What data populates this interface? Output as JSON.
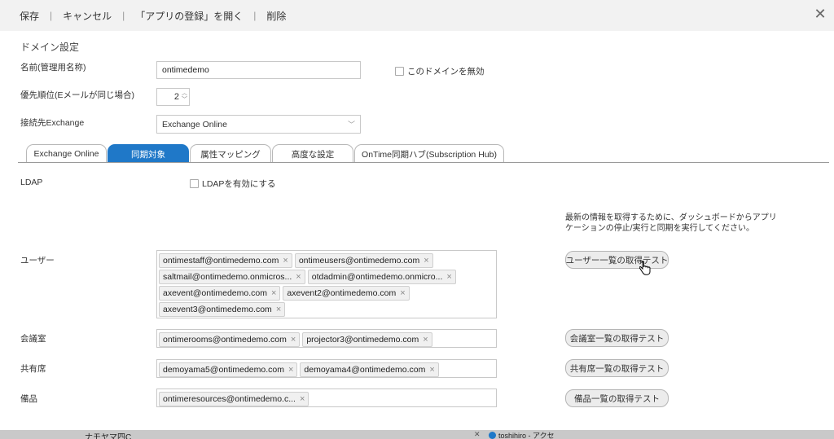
{
  "toolbar": {
    "save": "保存",
    "cancel": "キャンセル",
    "open_app_registration": "「アプリの登録」を開く",
    "delete": "削除",
    "separator": "|",
    "close": "✕"
  },
  "domain_settings": {
    "section_title": "ドメイン設定",
    "name_label": "名前(管理用名称)",
    "name_value": "ontimedemo",
    "disable_label": "このドメインを無効",
    "priority_label": "優先順位(Eメールが同じ場合)",
    "priority_value": "2",
    "exchange_label": "接続先Exchange",
    "exchange_value": "Exchange Online"
  },
  "tabs": [
    {
      "label": "Exchange Online",
      "active": false
    },
    {
      "label": "同期対象",
      "active": true
    },
    {
      "label": "属性マッピング",
      "active": false
    },
    {
      "label": "高度な設定",
      "active": false
    },
    {
      "label": "OnTime同期ハブ(Subscription Hub)",
      "active": false
    }
  ],
  "sync": {
    "ldap_label": "LDAP",
    "ldap_enable_label": "LDAPを有効にする",
    "info_text": "最新の情報を取得するために、ダッシュボードからアプリケーションの停止/実行と同期を実行してください。",
    "users_label": "ユーザー",
    "users_tags": [
      "ontimestaff@ontimedemo.com",
      "ontimeusers@ontimedemo.com",
      "saltmail@ontimedemo.onmicros...",
      "otdadmin@ontimedemo.onmicro...",
      "axevent@ontimedemo.com",
      "axevent2@ontimedemo.com",
      "axevent3@ontimedemo.com"
    ],
    "users_test": "ユーザー一覧の取得テスト",
    "rooms_label": "会議室",
    "rooms_tags": [
      "ontimerooms@ontimedemo.com",
      "projector3@ontimedemo.com"
    ],
    "rooms_test": "会議室一覧の取得テスト",
    "seats_label": "共有席",
    "seats_tags": [
      "demoyama5@ontimedemo.com",
      "demoyama4@ontimedemo.com"
    ],
    "seats_test": "共有席一覧の取得テスト",
    "equipment_label": "備品",
    "equipment_tags": [
      "ontimeresources@ontimedemo.c..."
    ],
    "equipment_test": "備品一覧の取得テスト"
  },
  "background": {
    "text1": "ナモヤマ四C",
    "text2": "toshihiro - アクセ",
    "close_glyph": "✕"
  }
}
